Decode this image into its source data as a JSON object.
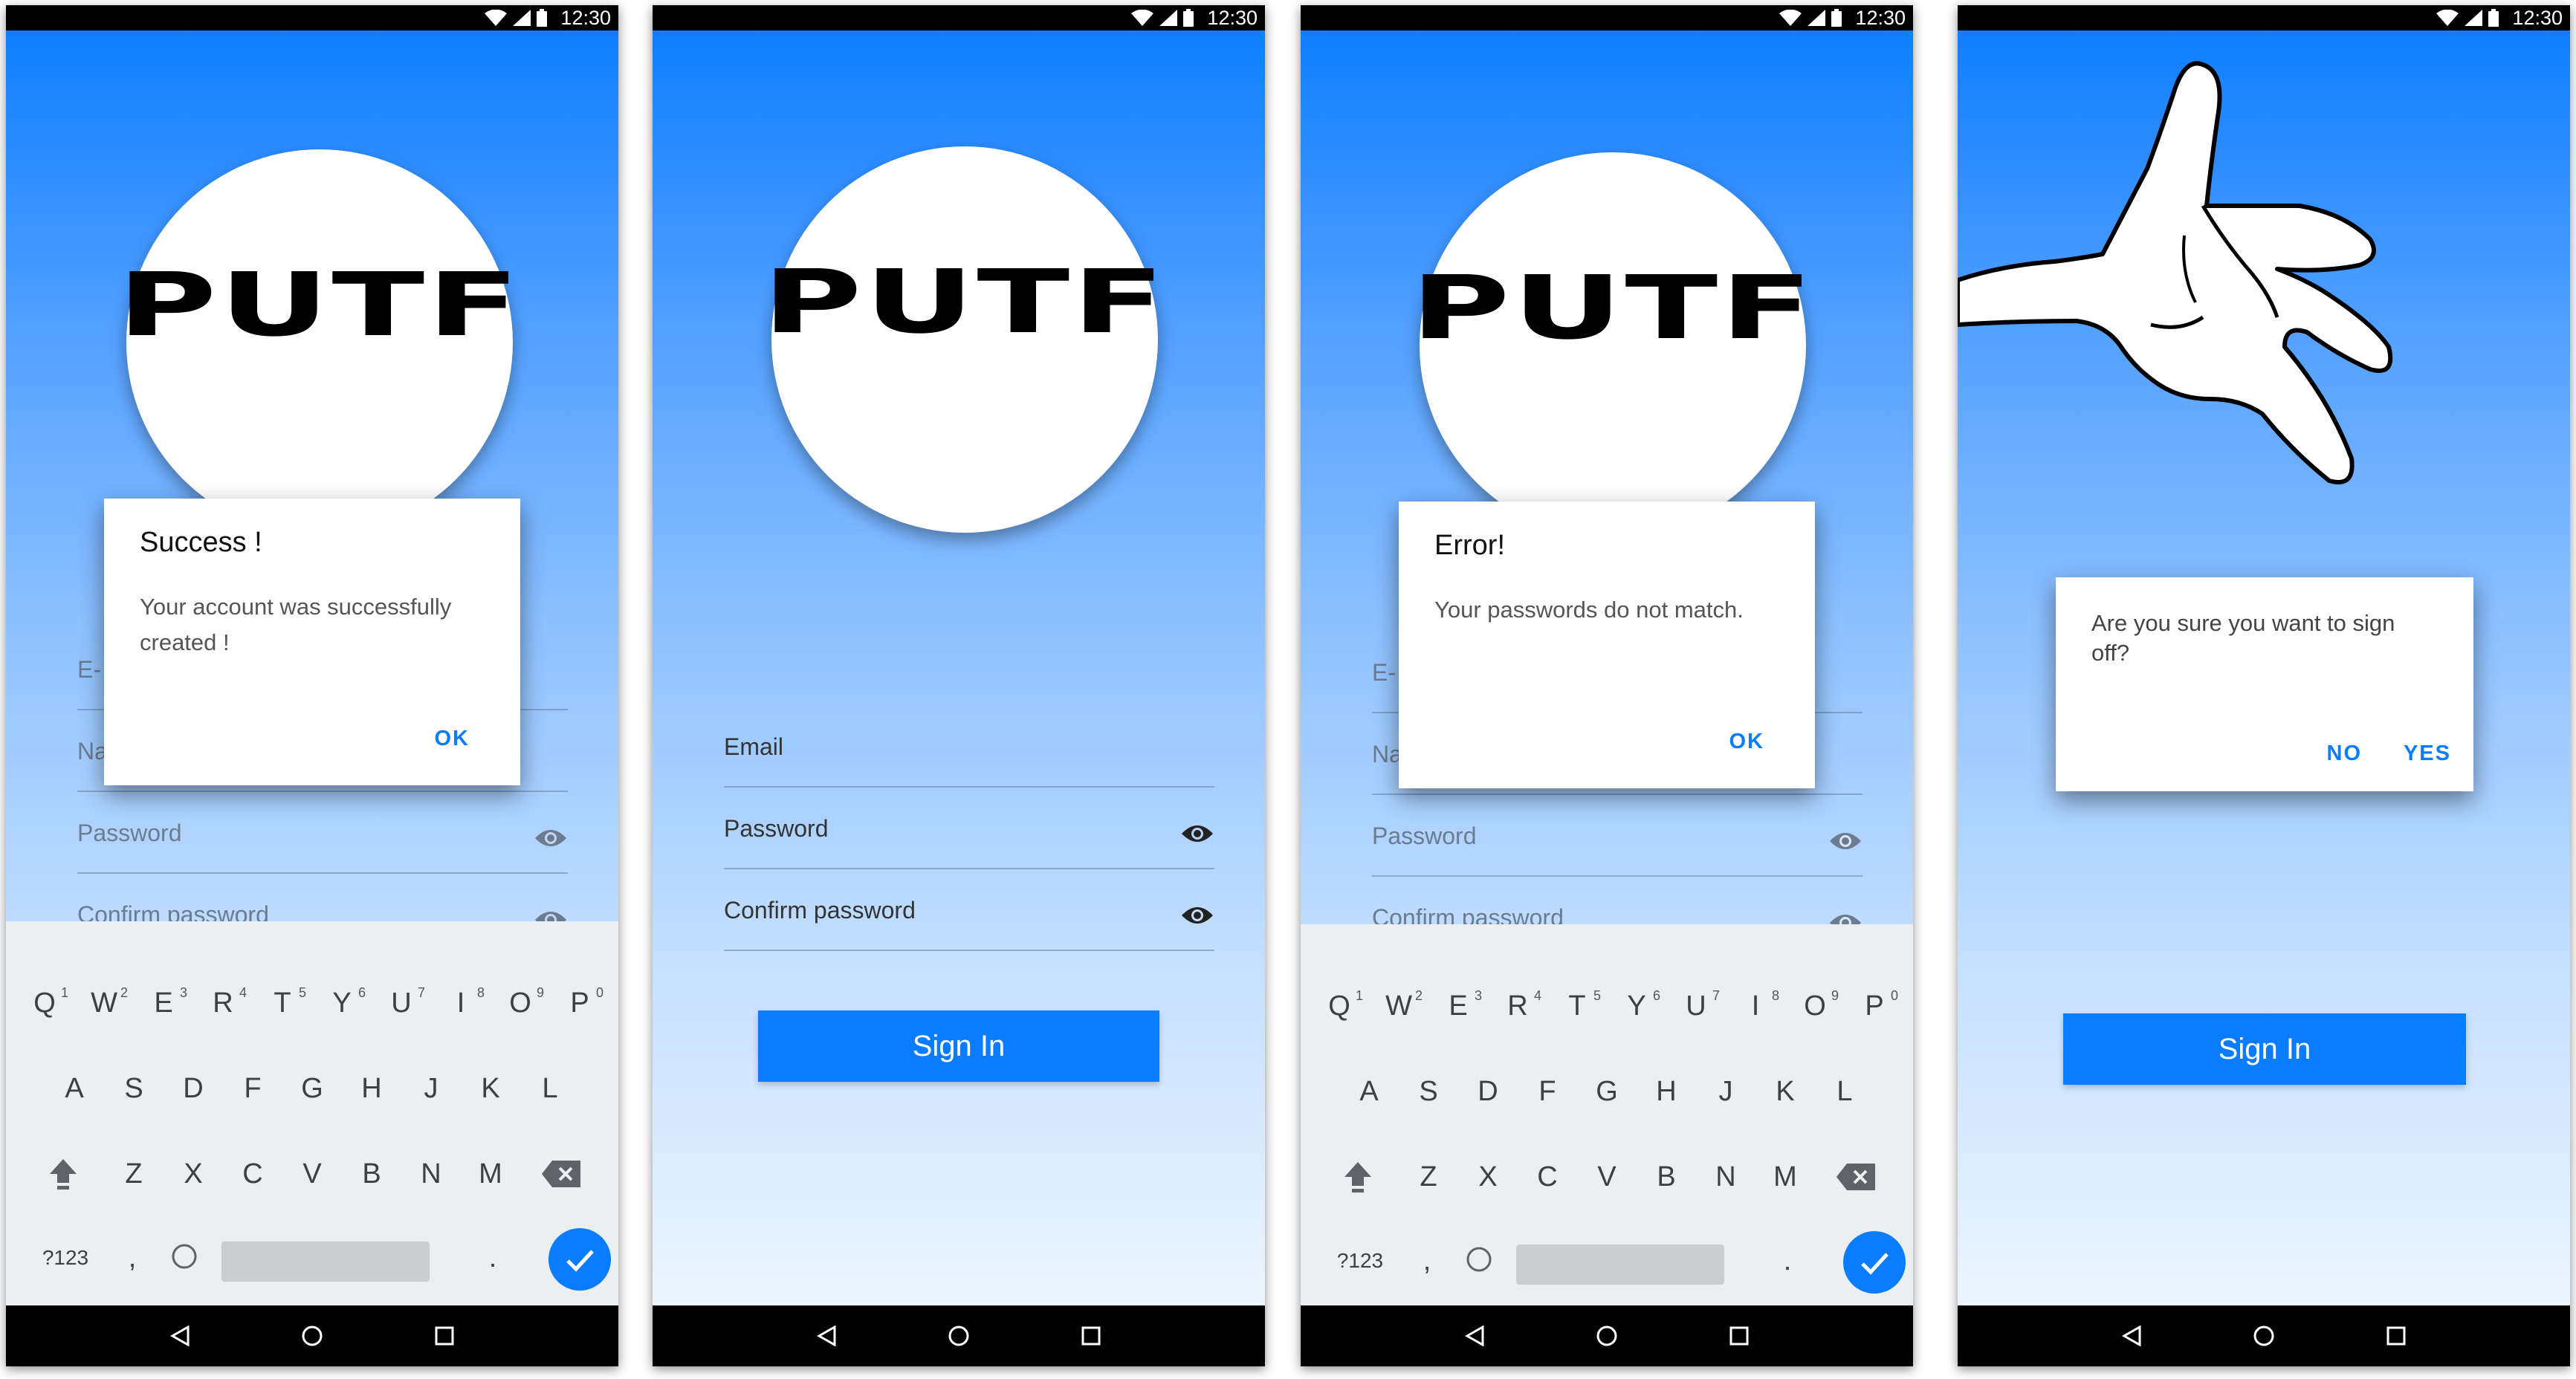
{
  "status_bar": {
    "time": "12:30"
  },
  "logo": {
    "text": "PUTF"
  },
  "screen1": {
    "fields": [
      {
        "label": "E-"
      },
      {
        "label": "Na"
      },
      {
        "label": "Password"
      },
      {
        "label": "Confirm password"
      }
    ],
    "dialog": {
      "title": "Success !",
      "body": "Your account was successfully created !",
      "ok": "OK"
    }
  },
  "screen2": {
    "fields": [
      {
        "label": "Email"
      },
      {
        "label": "Password"
      },
      {
        "label": "Confirm password"
      }
    ],
    "button": "Sign In"
  },
  "screen3": {
    "fields": [
      {
        "label": "E-"
      },
      {
        "label": "Na"
      },
      {
        "label": "Password"
      },
      {
        "label": "Confirm password"
      }
    ],
    "dialog": {
      "title": "Error!",
      "body": "Your passwords do not match.",
      "ok": "OK"
    }
  },
  "screen4": {
    "dialog": {
      "body": "Are you sure you want to sign off?",
      "no": "NO",
      "yes": "YES"
    },
    "button": "Sign In"
  },
  "keyboard": {
    "row1": [
      "Q",
      "W",
      "E",
      "R",
      "T",
      "Y",
      "U",
      "I",
      "O",
      "P"
    ],
    "row1_hints": [
      "1",
      "2",
      "3",
      "4",
      "5",
      "6",
      "7",
      "8",
      "9",
      "0"
    ],
    "row2": [
      "A",
      "S",
      "D",
      "F",
      "G",
      "H",
      "J",
      "K",
      "L"
    ],
    "row3": [
      "Z",
      "X",
      "C",
      "V",
      "B",
      "N",
      "M"
    ],
    "symbols_key": "?123",
    "comma": ",",
    "period": "."
  },
  "colors": {
    "accent": "#0a7cff",
    "dialog_bg": "#ffffff",
    "keyboard_bg": "#eceff1"
  },
  "icons": [
    "wifi-icon",
    "signal-icon",
    "battery-icon",
    "eye-icon",
    "shift-icon",
    "backspace-icon",
    "check-icon",
    "back-icon",
    "home-icon",
    "recents-icon",
    "hand-image"
  ]
}
